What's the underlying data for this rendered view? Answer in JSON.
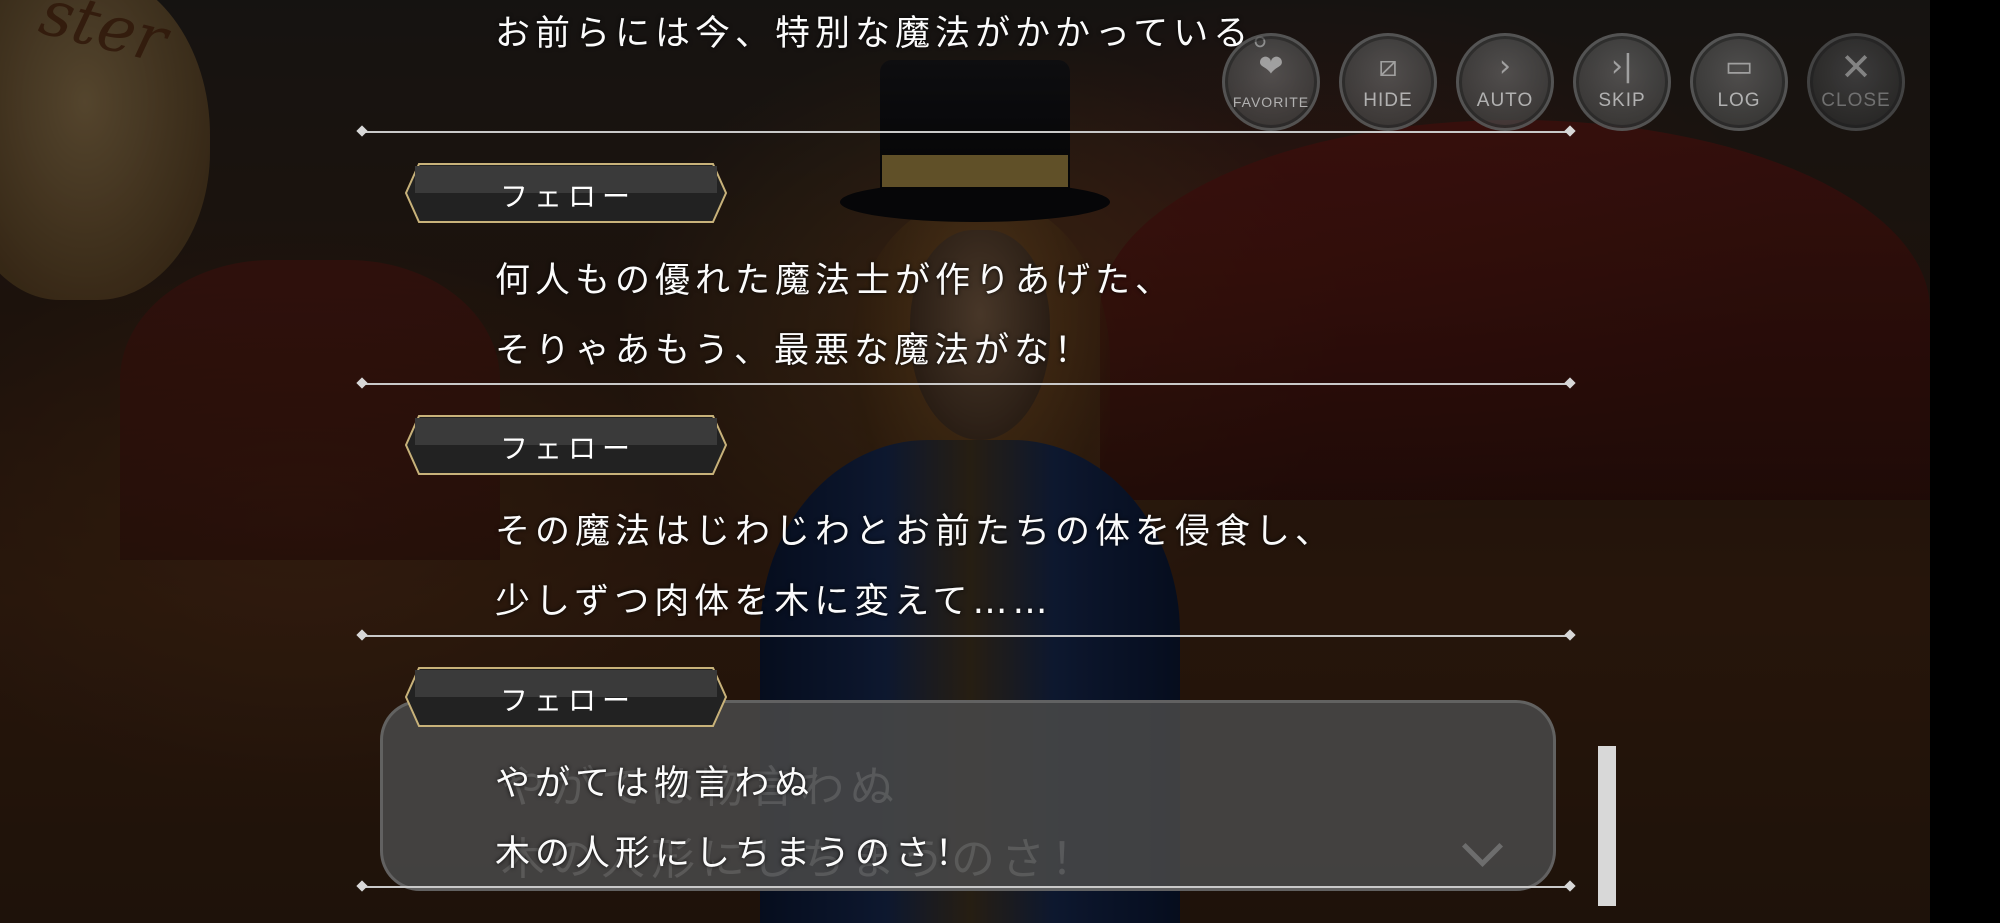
{
  "controls": {
    "favorite": {
      "label": "FAVORITE",
      "icon": "heart-icon"
    },
    "hide": {
      "label": "HIDE",
      "icon": "eye-slash-icon"
    },
    "auto": {
      "label": "AUTO",
      "icon": "play-icon"
    },
    "skip": {
      "label": "SKIP",
      "icon": "skip-icon"
    },
    "log": {
      "label": "LOG",
      "icon": "chat-bubble-icon"
    },
    "close": {
      "label": "CLOSE",
      "icon": "close-icon"
    }
  },
  "background": {
    "sign_text": "ster"
  },
  "backlog": {
    "top_line": "お前らには今、特別な魔法がかかっている。",
    "entries": [
      {
        "speaker": "フェロー",
        "lines": [
          "何人もの優れた魔法士が作りあげた、",
          "そりゃあもう、最悪な魔法がな！"
        ]
      },
      {
        "speaker": "フェロー",
        "lines": [
          "その魔法はじわじわとお前たちの体を侵食し、",
          "少しずつ肉体を木に変えて……"
        ]
      },
      {
        "speaker": "フェロー",
        "lines": [
          "やがては物言わぬ",
          "木の人形にしちまうのさ！"
        ]
      }
    ]
  },
  "dialog_box": {
    "ghost_lines": [
      "やがては物言わぬ",
      "木の人形にしちまうのさ！"
    ]
  },
  "colors": {
    "text": "#fbfbfb",
    "nameplate_border": "#c8b27a",
    "separator": "#c9c9c9"
  }
}
